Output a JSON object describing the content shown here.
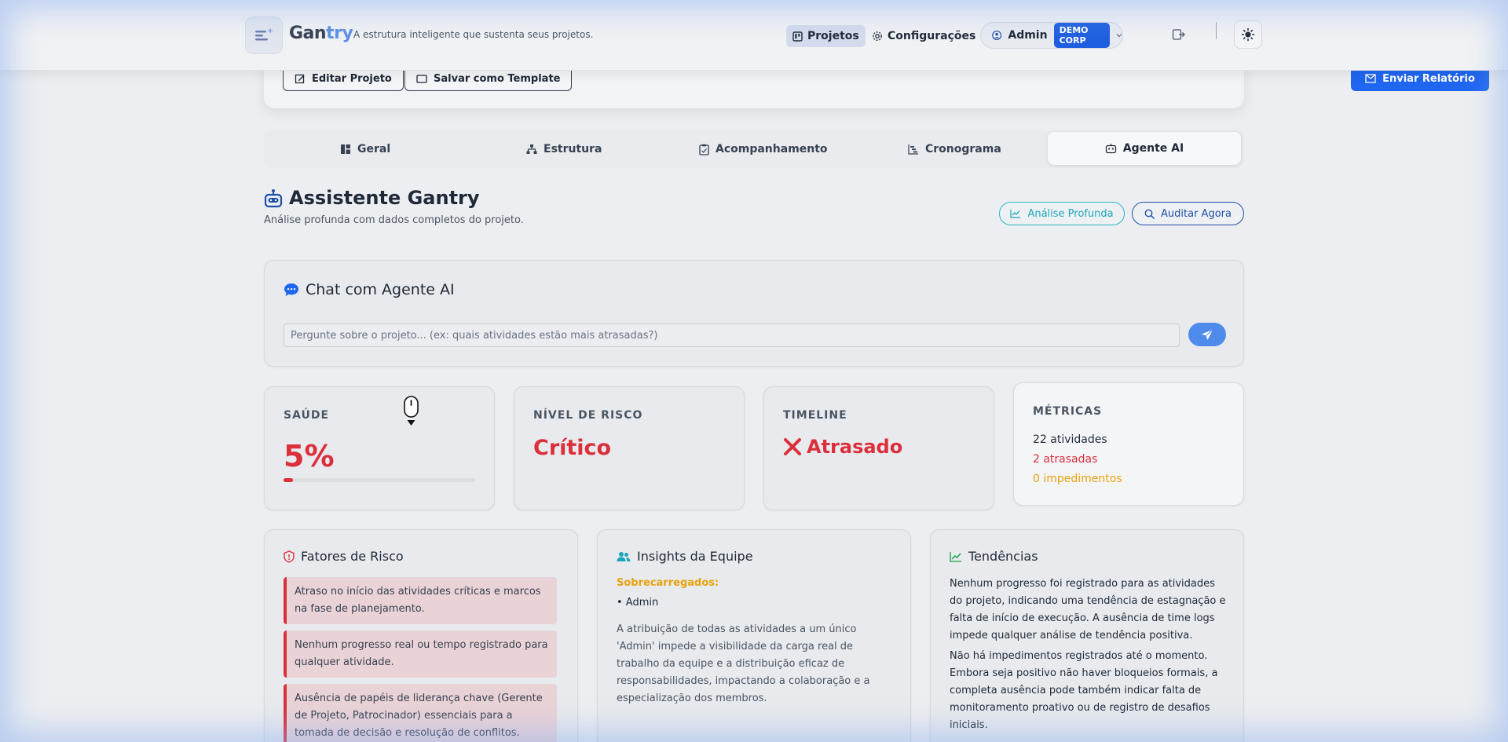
{
  "header": {
    "brand_main": "Gan",
    "brand_accent": "try",
    "tagline": "A estrutura inteligente que sustenta seus projetos.",
    "nav_projetos": "Projetos",
    "nav_config": "Configurações",
    "user_name": "Admin",
    "org_badge": "DEMO CORP"
  },
  "project_actions": {
    "edit": "Editar Projeto",
    "save_template": "Salvar como Template",
    "send_report": "Enviar Relatório"
  },
  "tabs": [
    {
      "label": "Geral",
      "icon": "dashboard-icon"
    },
    {
      "label": "Estrutura",
      "icon": "hierarchy-icon"
    },
    {
      "label": "Acompanhamento",
      "icon": "clipboard-icon"
    },
    {
      "label": "Cronograma",
      "icon": "gantt-icon"
    },
    {
      "label": "Agente AI",
      "icon": "robot-icon",
      "active": true
    }
  ],
  "assistant": {
    "title": "Assistente Gantry",
    "subtitle": "Análise profunda com dados completos do projeto.",
    "btn_analise": "Análise Profunda",
    "btn_auditar": "Auditar Agora"
  },
  "chat": {
    "title": "Chat com Agente AI",
    "placeholder": "Pergunte sobre o projeto... (ex: quais atividades estão mais atrasadas?)"
  },
  "metrics": {
    "saude_label": "SAÚDE",
    "saude_value": "5%",
    "saude_progress": 0.05,
    "risco_label": "NÍVEL DE RISCO",
    "risco_value": "Crítico",
    "timeline_label": "TIMELINE",
    "timeline_value": "Atrasado",
    "metricas_label": "MÉTRICAS",
    "atividades": "22 atividades",
    "atrasadas": "2 atrasadas",
    "impedimentos": "0 impedimentos"
  },
  "risk_factors": {
    "title": "Fatores de Risco",
    "items": [
      "Atraso no início das atividades críticas e marcos na fase de planejamento.",
      "Nenhum progresso real ou tempo registrado para qualquer atividade.",
      "Ausência de papéis de liderança chave (Gerente de Projeto, Patrocinador) essenciais para a tomada de decisão e resolução de conflitos."
    ]
  },
  "team_insights": {
    "title": "Insights da Equipe",
    "overloaded_label": "Sobrecarregados:",
    "overloaded_item": "• Admin",
    "text": "A atribuição de todas as atividades a um único 'Admin' impede a visibilidade da carga real de trabalho da equipe e a distribuição eficaz de responsabilidades, impactando a colaboração e a especialização dos membros."
  },
  "trends": {
    "title": "Tendências",
    "p1": "Nenhum progresso foi registrado para as atividades do projeto, indicando uma tendência de estagnação e falta de início de execução. A ausência de time logs impede qualquer análise de tendência positiva.",
    "p2": "Não há impedimentos registrados até o momento. Embora seja positivo não haver bloqueios formais, a completa ausência pode também indicar falta de monitoramento proativo ou de registro de desafios iniciais."
  },
  "colors": {
    "primary": "#1f66f0",
    "danger": "#dc2f3c",
    "warning": "#e8a20b",
    "teal": "#1aa6bb"
  }
}
